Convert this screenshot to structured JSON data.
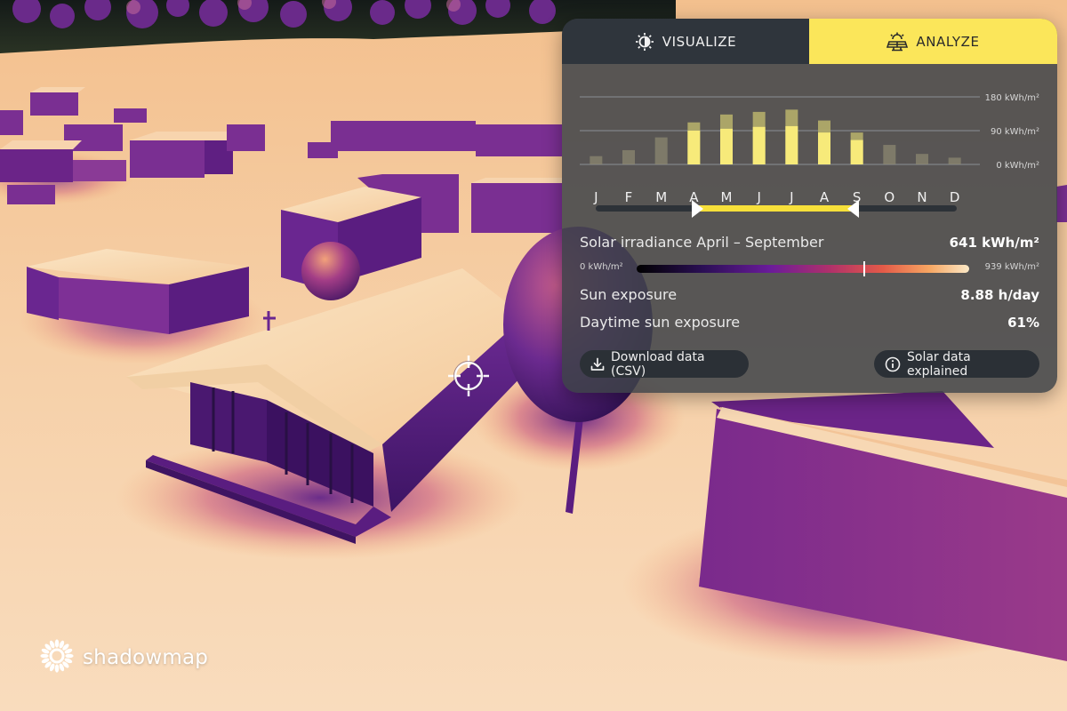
{
  "tabs": [
    {
      "label": "VISUALIZE",
      "icon": "sun-contrast-icon",
      "active": false
    },
    {
      "label": "ANALYZE",
      "icon": "solar-panel-icon",
      "active": true
    }
  ],
  "chart_data": {
    "type": "bar",
    "categories": [
      "J",
      "F",
      "M",
      "A",
      "M",
      "J",
      "J",
      "A",
      "S",
      "O",
      "N",
      "D"
    ],
    "series": [
      {
        "values": [
          22,
          38,
          72,
          112,
          133,
          140,
          146,
          117,
          85,
          52,
          28,
          18
        ]
      },
      {
        "values": [
          0,
          0,
          0,
          90,
          95,
          100,
          102,
          85,
          65,
          0,
          0,
          0
        ]
      }
    ],
    "y_ticks": [
      "180 kWh/m²",
      "90 kWh/m²",
      "0 kWh/m²"
    ],
    "ylim": [
      0,
      180
    ],
    "grid": true,
    "colors": {
      "selected": "#f7ea7a",
      "unselected": "#8f8a72",
      "grid": "#8a8f94"
    }
  },
  "range_slider": {
    "start_index": 3,
    "end_index": 8,
    "fill_color": "#f7e03a"
  },
  "irradiance": {
    "label": "Solar irradiance April – September",
    "value": "641 kWh/m²"
  },
  "scale": {
    "min": "0 kWh/m²",
    "max": "939 kWh/m²",
    "fraction": 0.683
  },
  "sun_exposure": {
    "label": "Sun exposure",
    "value": "8.88 h/day"
  },
  "daytime_exposure": {
    "label": "Daytime sun exposure",
    "value": "61%"
  },
  "buttons": {
    "download": {
      "label": "Download data (CSV)",
      "icon": "download-icon"
    },
    "explained": {
      "label": "Solar data explained",
      "icon": "info-icon"
    }
  },
  "brand": {
    "name": "shadowmap",
    "icon": "sun-logo-icon"
  }
}
